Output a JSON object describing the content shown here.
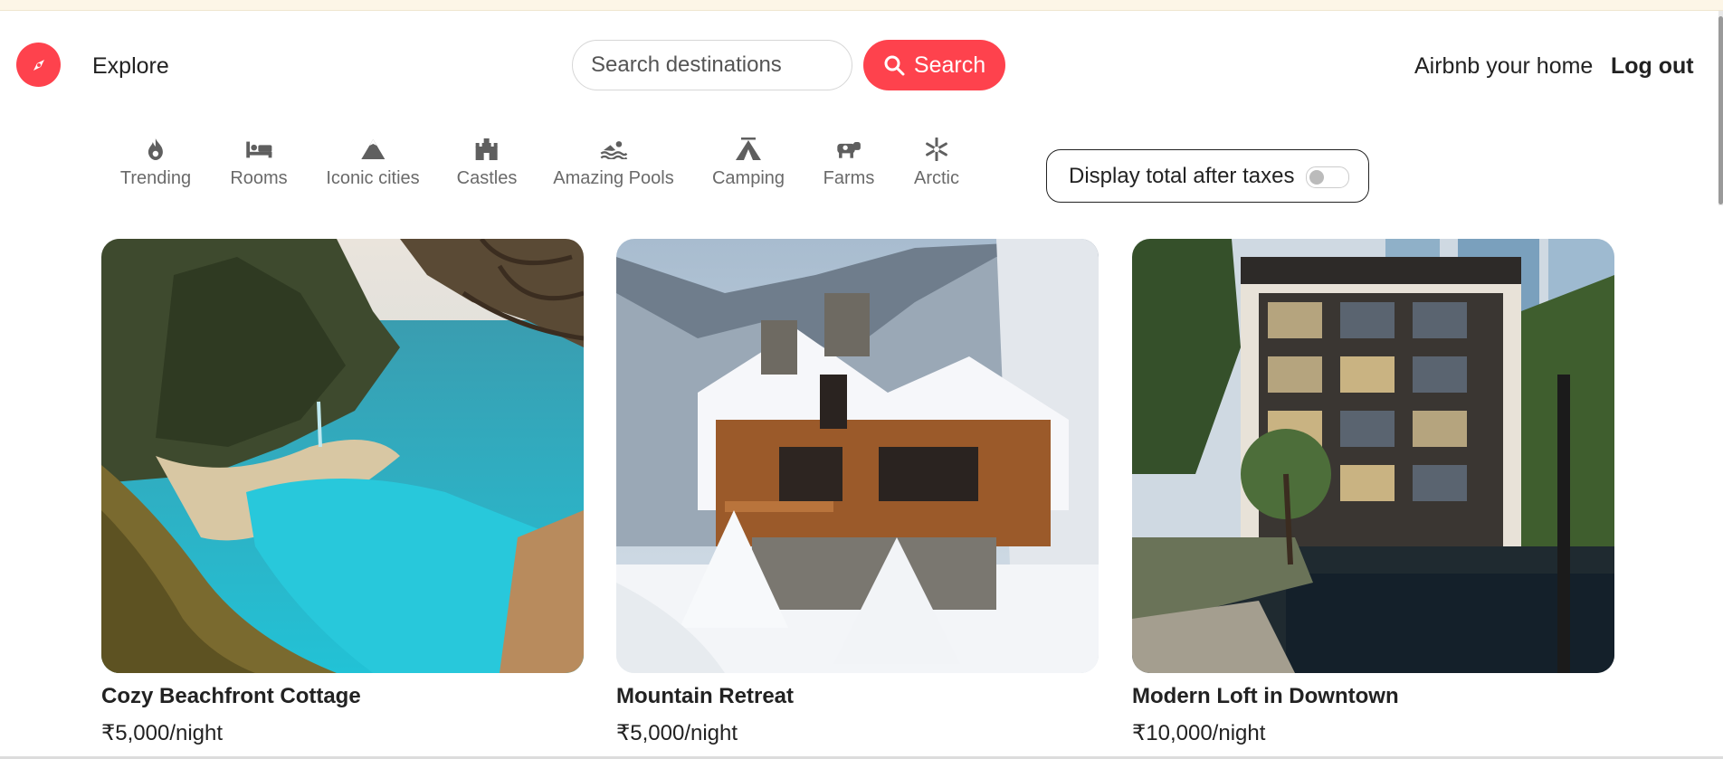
{
  "header": {
    "brand_icon": "compass-icon",
    "explore_label": "Explore",
    "search": {
      "placeholder": "Search destinations",
      "value": "",
      "button_label": "Search"
    },
    "host_label": "Airbnb your home",
    "logout_label": "Log out"
  },
  "filters": [
    {
      "icon": "fire-icon",
      "label": "Trending"
    },
    {
      "icon": "bed-icon",
      "label": "Rooms"
    },
    {
      "icon": "mountain-icon",
      "label": "Iconic cities"
    },
    {
      "icon": "castle-icon",
      "label": "Castles"
    },
    {
      "icon": "swimmer-icon",
      "label": "Amazing Pools"
    },
    {
      "icon": "tent-icon",
      "label": "Camping"
    },
    {
      "icon": "cow-icon",
      "label": "Farms"
    },
    {
      "icon": "snowflake-icon",
      "label": "Arctic"
    }
  ],
  "tax_toggle": {
    "label": "Display total after taxes",
    "enabled": false
  },
  "listings": [
    {
      "title": "Cozy Beachfront Cottage",
      "price": "₹5,000/night"
    },
    {
      "title": "Mountain Retreat",
      "price": "₹5,000/night"
    },
    {
      "title": "Modern Loft in Downtown",
      "price": "₹10,000/night"
    }
  ],
  "colors": {
    "brand": "#fe424d",
    "text": "#222222",
    "muted": "#6a6a6a"
  }
}
